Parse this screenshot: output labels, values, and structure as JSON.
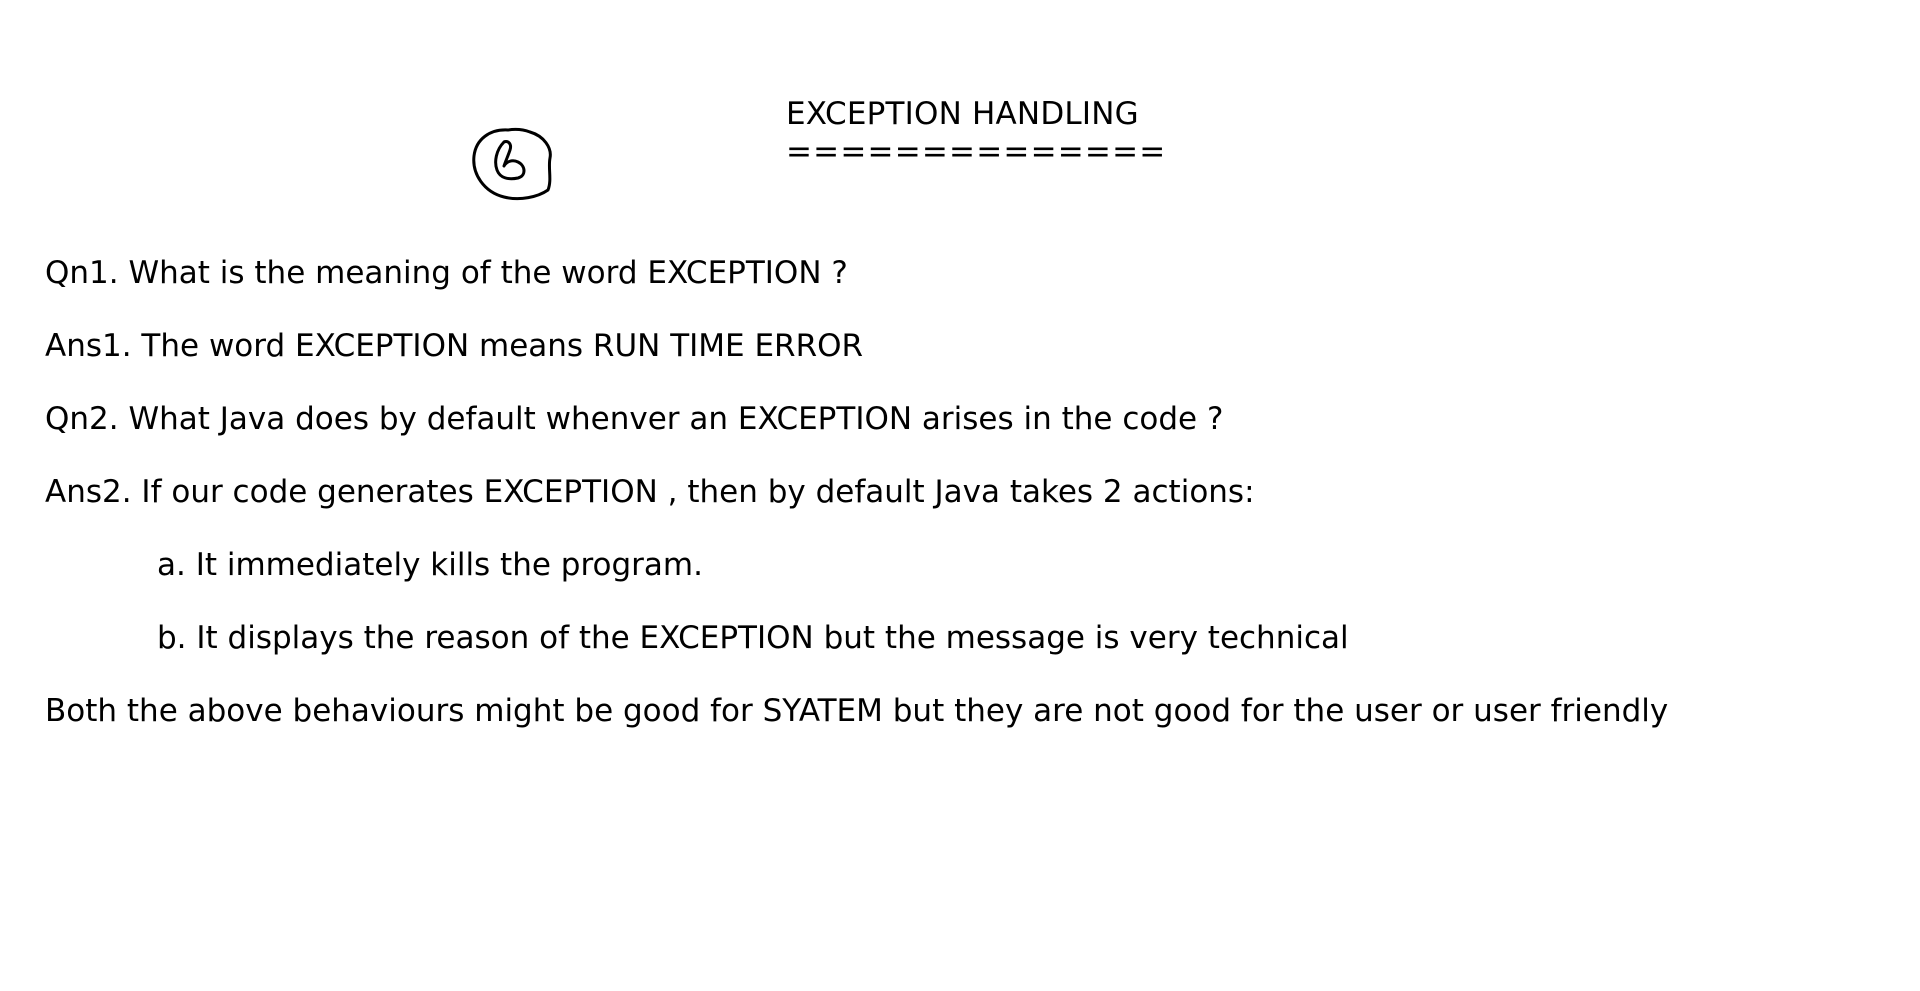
{
  "document": {
    "title": "EXCEPTION HANDLING",
    "title_underline": "==============",
    "lines": [
      "Qn1. What is the meaning of the word EXCEPTION ?",
      "Ans1. The word EXCEPTION means RUN TIME ERROR",
      "Qn2. What Java does by default whenver an EXCEPTION arises in the code ?",
      "Ans2. If our code generates EXCEPTION , then by default Java takes 2 actions:",
      "a. It immediately kills the program.",
      "b. It displays the reason of the EXCEPTION but the message is very technical",
      "Both the above behaviours might be good for SYATEM but they are not good for the user or user friendly"
    ]
  },
  "icons": {
    "handwritten_mark": "handwritten-circled-number-icon"
  },
  "colors": {
    "text": "#000000",
    "background": "#ffffff"
  }
}
